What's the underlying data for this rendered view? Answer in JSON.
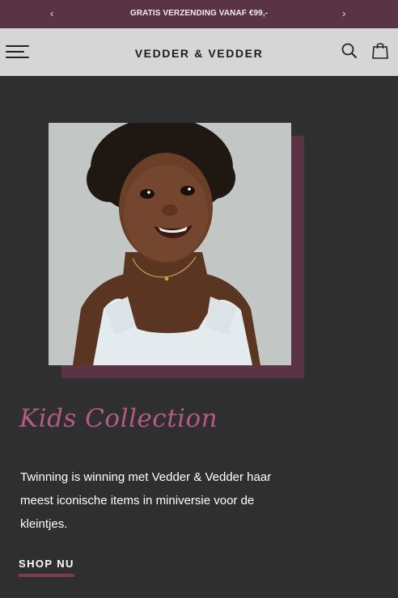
{
  "announcement": {
    "prev_icon": "chevron-left-icon",
    "next_icon": "chevron-right-icon",
    "message": "GRATIS VERZENDING VANAF €99,-",
    "prev_glyph": "‹",
    "next_glyph": "›"
  },
  "header": {
    "menu_icon": "hamburger-menu-icon",
    "logo": "VEDDER & VEDDER",
    "search_icon": "search-icon",
    "cart_icon": "shopping-bag-icon"
  },
  "hero": {
    "title": "Kids Collection",
    "description": "Twinning is winning met Vedder & Vedder haar meest iconische items in miniversie voor de kleintjes.",
    "cta_label": "SHOP NU"
  },
  "colors": {
    "announcement_bg": "#5a3345",
    "header_bg": "#d6d6d6",
    "page_bg": "#2f2f2f",
    "accent": "#b35a86",
    "cta_underline": "#7b3c5a"
  }
}
